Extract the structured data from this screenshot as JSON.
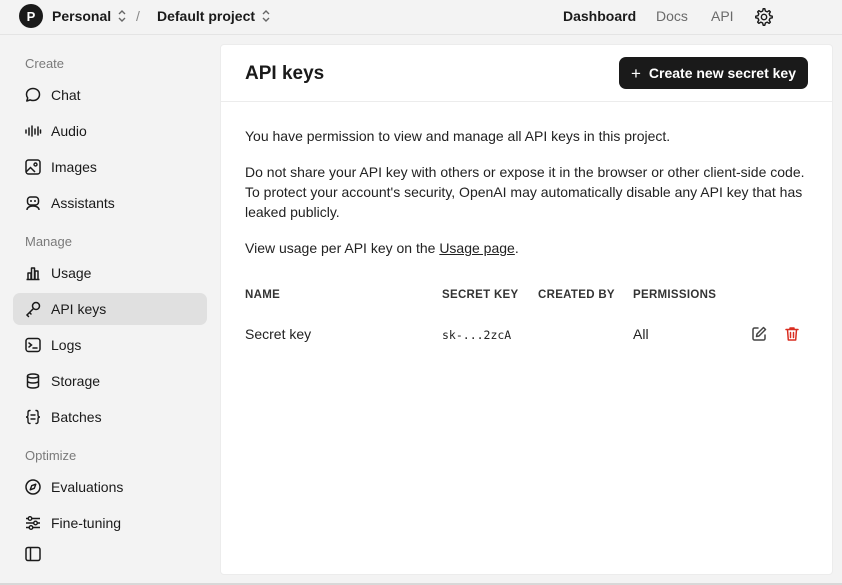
{
  "header": {
    "avatar_letter": "P",
    "org": "Personal",
    "separator": "/",
    "project": "Default project",
    "nav": {
      "dashboard": "Dashboard",
      "docs": "Docs",
      "api": "API"
    }
  },
  "sidebar": {
    "sections": {
      "create": "Create",
      "manage": "Manage",
      "optimize": "Optimize"
    },
    "items": [
      {
        "label": "Chat",
        "icon": "chat-bubble-icon"
      },
      {
        "label": "Audio",
        "icon": "audio-wave-icon"
      },
      {
        "label": "Images",
        "icon": "image-icon"
      },
      {
        "label": "Assistants",
        "icon": "robot-icon"
      },
      {
        "label": "Usage",
        "icon": "bar-chart-icon"
      },
      {
        "label": "API keys",
        "icon": "key-icon"
      },
      {
        "label": "Logs",
        "icon": "terminal-icon"
      },
      {
        "label": "Storage",
        "icon": "database-icon"
      },
      {
        "label": "Batches",
        "icon": "braces-icon"
      },
      {
        "label": "Evaluations",
        "icon": "compass-icon"
      },
      {
        "label": "Fine-tuning",
        "icon": "sliders-icon"
      }
    ],
    "active_item": "API keys"
  },
  "main": {
    "title": "API keys",
    "create_button": "Create new secret key",
    "paragraph1": "You have permission to view and manage all API keys in this project.",
    "paragraph2": "Do not share your API key with others or expose it in the browser or other client-side code. To protect your account's security, OpenAI may automatically disable any API key that has leaked publicly.",
    "paragraph3_prefix": "View usage per API key on the ",
    "paragraph3_link": "Usage page",
    "paragraph3_suffix": ".",
    "table": {
      "columns": [
        "NAME",
        "SECRET KEY",
        "CREATED BY",
        "PERMISSIONS"
      ],
      "rows": [
        {
          "name": "Secret key",
          "secret_key": "sk-...2zcA",
          "created_by": "",
          "permissions": "All"
        }
      ]
    }
  },
  "colors": {
    "accent_dark": "#1a1a1a",
    "danger": "#d92d20",
    "sidebar_bg": "#f3f3f3",
    "active_bg": "#e0e0e0"
  }
}
